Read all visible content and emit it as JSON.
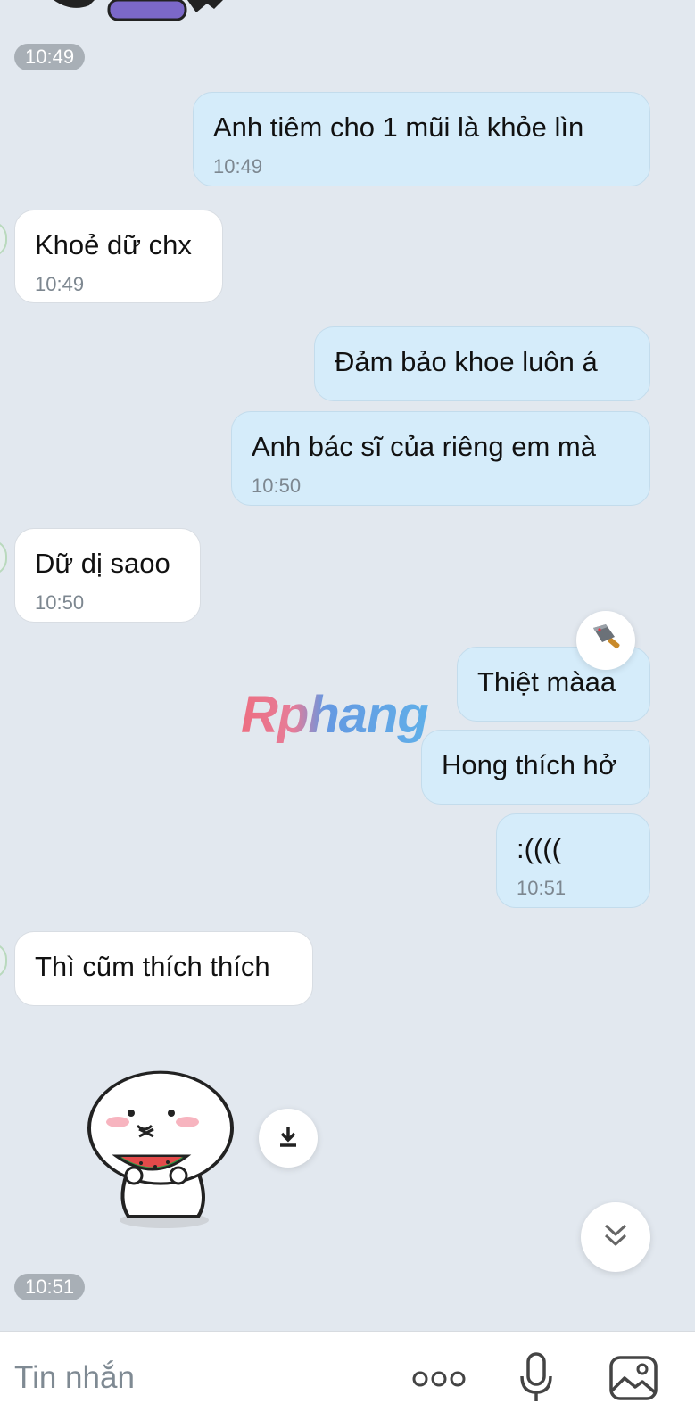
{
  "top_time": "10:49",
  "messages": [
    {
      "text": "Anh tiêm cho 1 mũi là khỏe lìn",
      "time": "10:49"
    },
    {
      "text": "Khoẻ dữ chx",
      "time": "10:49"
    },
    {
      "text": "Đảm bảo khoe luôn á"
    },
    {
      "text": "Anh bác sĩ của riêng em mà",
      "time": "10:50"
    },
    {
      "text": "Dữ dị saoo",
      "time": "10:50"
    },
    {
      "text": "Thiệt màaa"
    },
    {
      "text": "Hong thích hở"
    },
    {
      "text": ":((((",
      "time": "10:51"
    },
    {
      "text": "Thì cũm thích thích"
    }
  ],
  "sticker_time": "10:51",
  "watermark": "Rphang",
  "composer": {
    "placeholder": "Tin nhắn"
  },
  "icons": {
    "reaction": "cleaver-icon",
    "download": "download-icon",
    "scroll_down": "double-chevron-down-icon",
    "more": "more-dots-icon",
    "mic": "microphone-icon",
    "image": "image-icon"
  },
  "colors": {
    "background": "#e2e8ef",
    "outgoing_bubble": "#d5ecfa",
    "incoming_bubble": "#ffffff",
    "time_pill": "#a8afb6"
  }
}
